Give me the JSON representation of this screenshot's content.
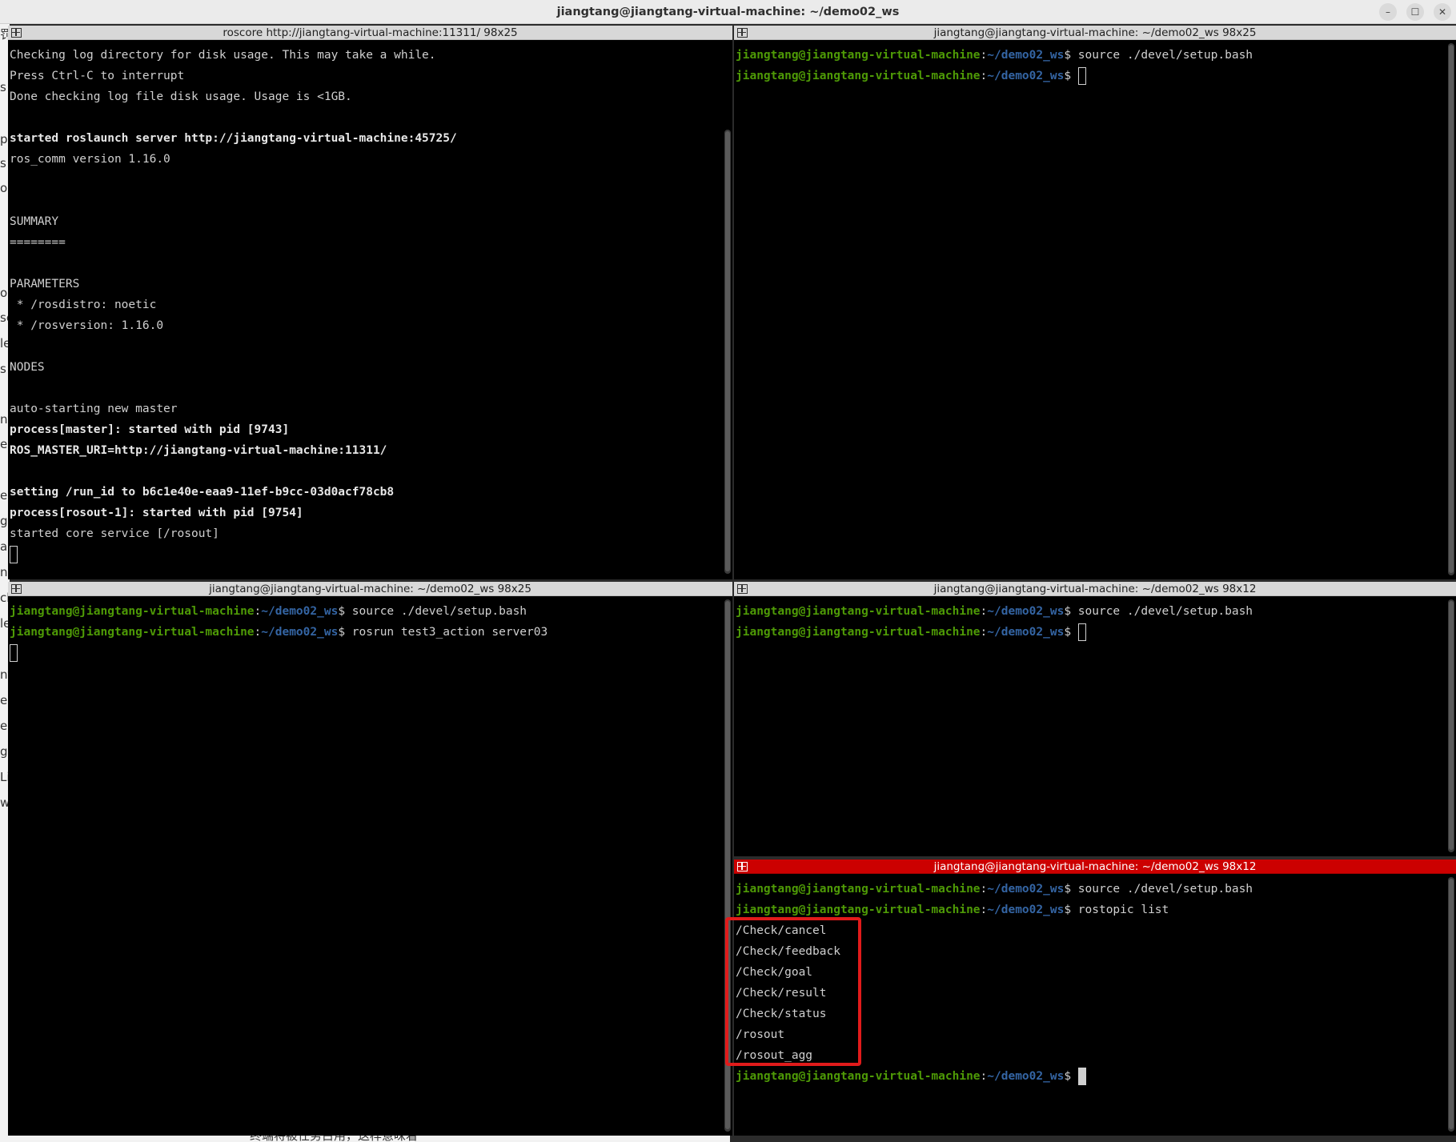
{
  "window": {
    "title": "jiangtang@jiangtang-virtual-machine: ~/demo02_ws",
    "controls": {
      "minimize": "–",
      "maximize": "☐",
      "close": "✕"
    }
  },
  "prompt": {
    "user": "jiangtang@jiangtang-virtual-machine",
    "colon": ":",
    "path": "~/demo02_ws",
    "dollar": "$ "
  },
  "background": {
    "fragments": [
      "罚",
      "s",
      "p",
      "s",
      "o",
      "ou",
      "se",
      "le",
      "s",
      "nt",
      "e",
      "e",
      "g",
      "ac",
      "n",
      "ck",
      "le",
      "nt",
      "e",
      "e",
      "g",
      "Li",
      "w"
    ],
    "bottom_text": "终端将被任务占用，这样意味着"
  },
  "panes": {
    "roscore": {
      "title": "roscore http://jiangtang-virtual-machine:11311/ 98x25",
      "lines": [
        {
          "text": "Checking log directory for disk usage. This may take a while.",
          "bold": false
        },
        {
          "text": "Press Ctrl-C to interrupt",
          "bold": false
        },
        {
          "text": "Done checking log file disk usage. Usage is <1GB.",
          "bold": false
        },
        {
          "text": "",
          "bold": false
        },
        {
          "text": "started roslaunch server http://jiangtang-virtual-machine:45725/",
          "bold": true
        },
        {
          "text": "ros_comm version 1.16.0",
          "bold": false
        },
        {
          "text": "",
          "bold": false
        },
        {
          "text": "",
          "bold": false
        },
        {
          "text": "SUMMARY",
          "bold": false
        },
        {
          "text": "========",
          "bold": false
        },
        {
          "text": "",
          "bold": false
        },
        {
          "text": "PARAMETERS",
          "bold": false
        },
        {
          "text": " * /rosdistro: noetic",
          "bold": false
        },
        {
          "text": " * /rosversion: 1.16.0",
          "bold": false
        },
        {
          "text": "",
          "bold": false
        },
        {
          "text": "NODES",
          "bold": false
        },
        {
          "text": "",
          "bold": false
        },
        {
          "text": "auto-starting new master",
          "bold": false
        },
        {
          "text": "process[master]: started with pid [9743]",
          "bold": true
        },
        {
          "text": "ROS_MASTER_URI=http://jiangtang-virtual-machine:11311/",
          "bold": true
        },
        {
          "text": "",
          "bold": false
        },
        {
          "text": "setting /run_id to b6c1e40e-eaa9-11ef-b9cc-03d0acf78cb8",
          "bold": true
        },
        {
          "text": "process[rosout-1]: started with pid [9754]",
          "bold": true
        },
        {
          "text": "started core service [/rosout]",
          "bold": false
        }
      ]
    },
    "top_right": {
      "title": "jiangtang@jiangtang-virtual-machine: ~/demo02_ws 98x25",
      "commands": [
        "source ./devel/setup.bash",
        ""
      ]
    },
    "server": {
      "title": "jiangtang@jiangtang-virtual-machine: ~/demo02_ws 98x25",
      "commands": [
        "source ./devel/setup.bash",
        "rosrun test3_action server03"
      ]
    },
    "middle_right": {
      "title": "jiangtang@jiangtang-virtual-machine: ~/demo02_ws 98x12",
      "commands": [
        "source ./devel/setup.bash",
        ""
      ]
    },
    "topics": {
      "title": "jiangtang@jiangtang-virtual-machine: ~/demo02_ws 98x12",
      "commands": [
        "source ./devel/setup.bash",
        "rostopic list"
      ],
      "topic_list": [
        "/Check/cancel",
        "/Check/feedback",
        "/Check/goal",
        "/Check/result",
        "/Check/status",
        "/rosout",
        "/rosout_agg"
      ]
    }
  },
  "colors": {
    "prompt_user": "#4e9a06",
    "prompt_path": "#3465a4",
    "active_header": "#cc0000",
    "highlight_box": "#e11b1b"
  }
}
